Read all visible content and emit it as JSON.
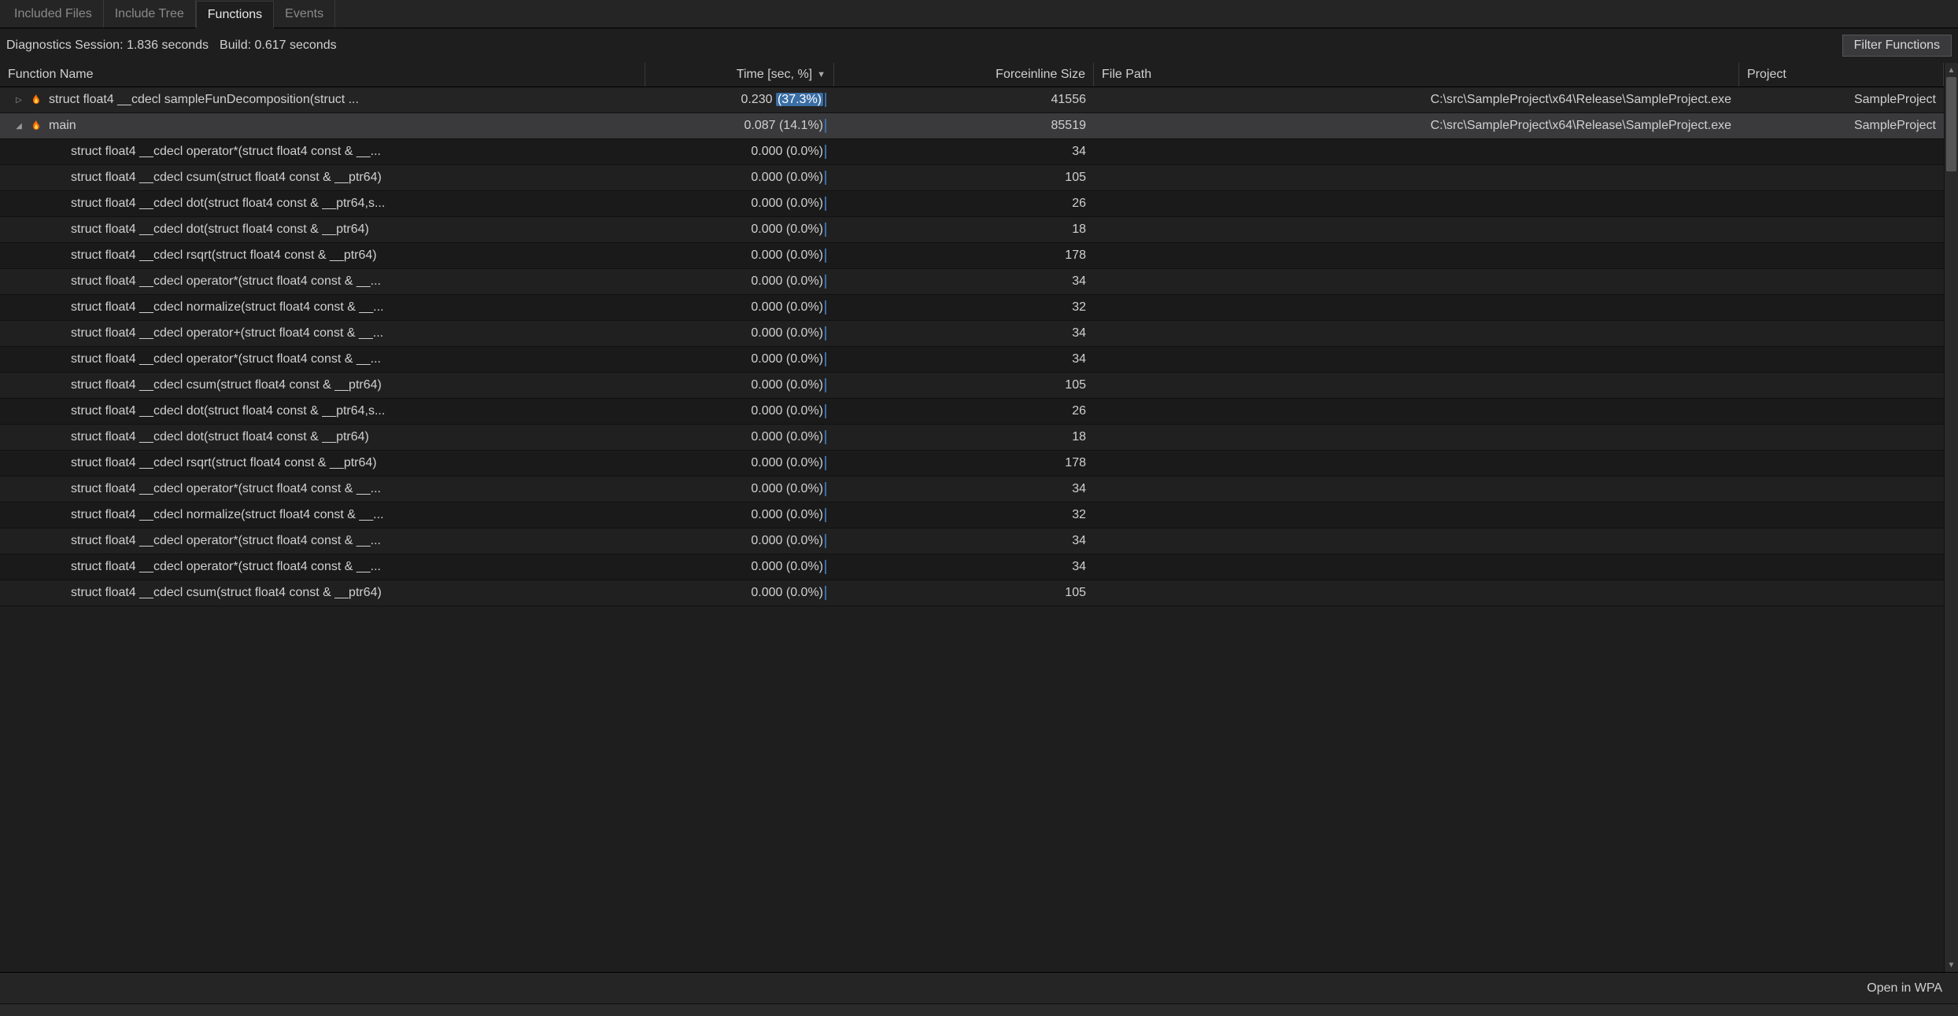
{
  "tabs": {
    "included_files": "Included Files",
    "include_tree": "Include Tree",
    "functions": "Functions",
    "events": "Events"
  },
  "status": {
    "session": "Diagnostics Session: 1.836 seconds",
    "build": "Build: 0.617 seconds",
    "filter_button": "Filter Functions"
  },
  "columns": {
    "name": "Function Name",
    "time": "Time [sec, %]",
    "size": "Forceinline Size",
    "path": "File Path",
    "project": "Project"
  },
  "rows": [
    {
      "level": 0,
      "expander": "▷",
      "flame": true,
      "name": "struct float4 __cdecl sampleFunDecomposition(struct ...",
      "time_main": "0.230 ",
      "time_pct": "(37.3%)",
      "highlight_pct": true,
      "size": "41556",
      "path": "C:\\src\\SampleProject\\x64\\Release\\SampleProject.exe",
      "project": "SampleProject",
      "cls": "top"
    },
    {
      "level": 0,
      "expander": "◢",
      "flame": true,
      "name": "main",
      "time_main": "0.087 ",
      "time_pct": "(14.1%)",
      "highlight_pct": false,
      "size": "85519",
      "path": "C:\\src\\SampleProject\\x64\\Release\\SampleProject.exe",
      "project": "SampleProject",
      "cls": "selected"
    },
    {
      "level": 1,
      "name": "struct float4 __cdecl operator*(struct float4 const & __...",
      "time_main": "0.000 ",
      "time_pct": "(0.0%)",
      "size": "34",
      "path": "",
      "project": "",
      "cls": ""
    },
    {
      "level": 1,
      "name": "struct float4 __cdecl csum(struct float4 const & __ptr64)",
      "time_main": "0.000 ",
      "time_pct": "(0.0%)",
      "size": "105",
      "path": "",
      "project": "",
      "cls": "alt"
    },
    {
      "level": 1,
      "name": "struct float4 __cdecl dot(struct float4 const & __ptr64,s...",
      "time_main": "0.000 ",
      "time_pct": "(0.0%)",
      "size": "26",
      "path": "",
      "project": "",
      "cls": ""
    },
    {
      "level": 1,
      "name": "struct float4 __cdecl dot(struct float4 const & __ptr64)",
      "time_main": "0.000 ",
      "time_pct": "(0.0%)",
      "size": "18",
      "path": "",
      "project": "",
      "cls": "alt"
    },
    {
      "level": 1,
      "name": "struct float4 __cdecl rsqrt(struct float4 const & __ptr64)",
      "time_main": "0.000 ",
      "time_pct": "(0.0%)",
      "size": "178",
      "path": "",
      "project": "",
      "cls": ""
    },
    {
      "level": 1,
      "name": "struct float4 __cdecl operator*(struct float4 const & __...",
      "time_main": "0.000 ",
      "time_pct": "(0.0%)",
      "size": "34",
      "path": "",
      "project": "",
      "cls": "alt"
    },
    {
      "level": 1,
      "name": "struct float4 __cdecl normalize(struct float4 const & __...",
      "time_main": "0.000 ",
      "time_pct": "(0.0%)",
      "size": "32",
      "path": "",
      "project": "",
      "cls": ""
    },
    {
      "level": 1,
      "name": "struct float4 __cdecl operator+(struct float4 const & __...",
      "time_main": "0.000 ",
      "time_pct": "(0.0%)",
      "size": "34",
      "path": "",
      "project": "",
      "cls": "alt"
    },
    {
      "level": 1,
      "name": "struct float4 __cdecl operator*(struct float4 const & __...",
      "time_main": "0.000 ",
      "time_pct": "(0.0%)",
      "size": "34",
      "path": "",
      "project": "",
      "cls": ""
    },
    {
      "level": 1,
      "name": "struct float4 __cdecl csum(struct float4 const & __ptr64)",
      "time_main": "0.000 ",
      "time_pct": "(0.0%)",
      "size": "105",
      "path": "",
      "project": "",
      "cls": "alt"
    },
    {
      "level": 1,
      "name": "struct float4 __cdecl dot(struct float4 const & __ptr64,s...",
      "time_main": "0.000 ",
      "time_pct": "(0.0%)",
      "size": "26",
      "path": "",
      "project": "",
      "cls": ""
    },
    {
      "level": 1,
      "name": "struct float4 __cdecl dot(struct float4 const & __ptr64)",
      "time_main": "0.000 ",
      "time_pct": "(0.0%)",
      "size": "18",
      "path": "",
      "project": "",
      "cls": "alt"
    },
    {
      "level": 1,
      "name": "struct float4 __cdecl rsqrt(struct float4 const & __ptr64)",
      "time_main": "0.000 ",
      "time_pct": "(0.0%)",
      "size": "178",
      "path": "",
      "project": "",
      "cls": ""
    },
    {
      "level": 1,
      "name": "struct float4 __cdecl operator*(struct float4 const & __...",
      "time_main": "0.000 ",
      "time_pct": "(0.0%)",
      "size": "34",
      "path": "",
      "project": "",
      "cls": "alt"
    },
    {
      "level": 1,
      "name": "struct float4 __cdecl normalize(struct float4 const & __...",
      "time_main": "0.000 ",
      "time_pct": "(0.0%)",
      "size": "32",
      "path": "",
      "project": "",
      "cls": ""
    },
    {
      "level": 1,
      "name": "struct float4 __cdecl operator*(struct float4 const & __...",
      "time_main": "0.000 ",
      "time_pct": "(0.0%)",
      "size": "34",
      "path": "",
      "project": "",
      "cls": "alt"
    },
    {
      "level": 1,
      "name": "struct float4 __cdecl operator*(struct float4 const & __...",
      "time_main": "0.000 ",
      "time_pct": "(0.0%)",
      "size": "34",
      "path": "",
      "project": "",
      "cls": ""
    },
    {
      "level": 1,
      "name": "struct float4 __cdecl csum(struct float4 const & __ptr64)",
      "time_main": "0.000 ",
      "time_pct": "(0.0%)",
      "size": "105",
      "path": "",
      "project": "",
      "cls": "alt"
    }
  ],
  "footer": {
    "open_wpa": "Open in WPA"
  }
}
